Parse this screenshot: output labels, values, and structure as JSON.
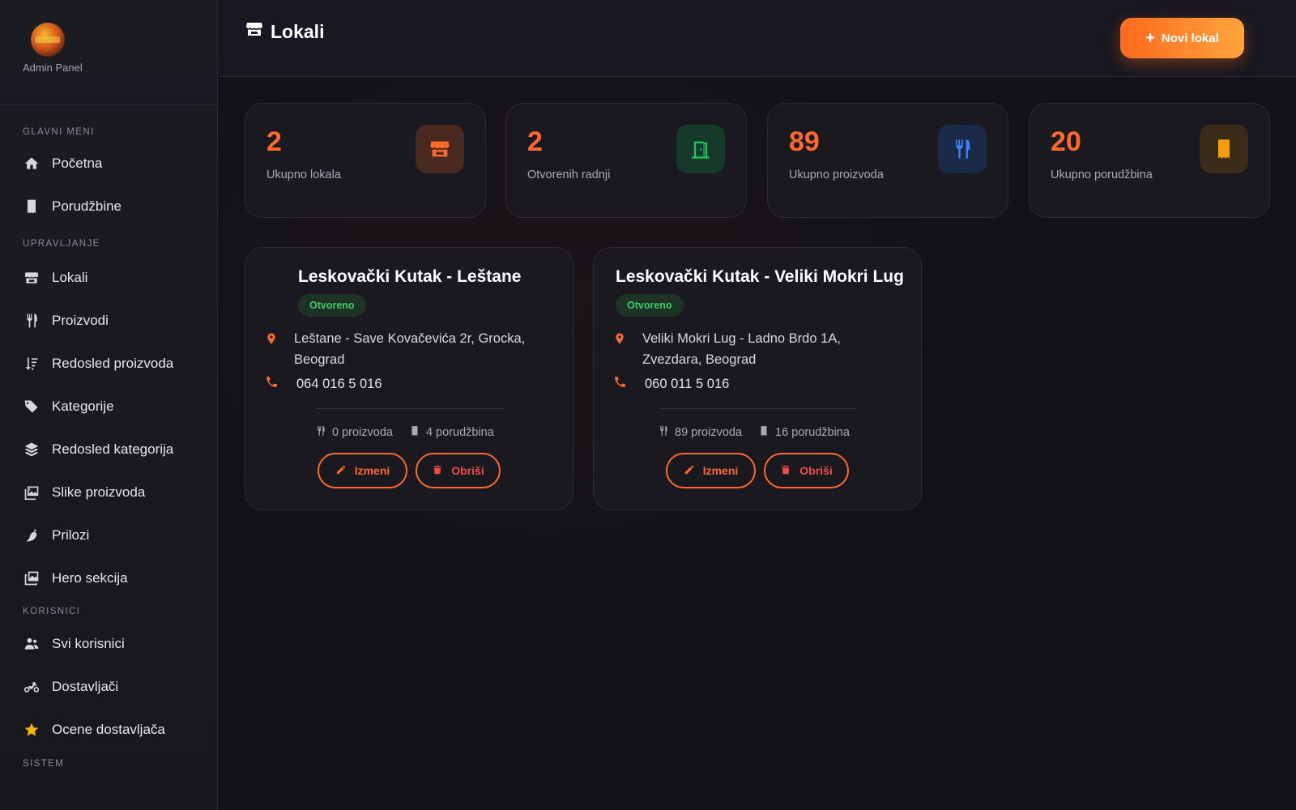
{
  "sidebar": {
    "brand_subtitle": "Admin Panel",
    "sections": [
      {
        "label": "GLAVNI MENI"
      },
      {
        "label": "UPRAVLJANJE"
      },
      {
        "label": "KORISNICI"
      },
      {
        "label": "SISTEM"
      }
    ],
    "items": [
      {
        "label": "Početna",
        "icon": "home-icon"
      },
      {
        "label": "Porudžbine",
        "icon": "receipt-icon"
      },
      {
        "label": "Lokali",
        "icon": "store-icon"
      },
      {
        "label": "Proizvodi",
        "icon": "utensils-icon"
      },
      {
        "label": "Redosled proizvoda",
        "icon": "sort-icon"
      },
      {
        "label": "Kategorije",
        "icon": "tags-icon"
      },
      {
        "label": "Redosled kategorija",
        "icon": "layers-icon"
      },
      {
        "label": "Slike proizvoda",
        "icon": "images-icon"
      },
      {
        "label": "Prilozi",
        "icon": "pepper-icon"
      },
      {
        "label": "Hero sekcija",
        "icon": "photo-film-icon"
      },
      {
        "label": "Svi korisnici",
        "icon": "users-icon"
      },
      {
        "label": "Dostavljači",
        "icon": "motorcycle-icon"
      },
      {
        "label": "Ocene dostavljača",
        "icon": "star-icon"
      }
    ]
  },
  "header": {
    "title": "Lokali",
    "new_button_label": "Novi lokal"
  },
  "stats": [
    {
      "value": "2",
      "label": "Ukupno lokala",
      "icon": "store-icon",
      "color": "#ff6a2a"
    },
    {
      "value": "2",
      "label": "Otvorenih radnji",
      "icon": "door-open-icon",
      "color": "#22c55e"
    },
    {
      "value": "89",
      "label": "Ukupno proizvoda",
      "icon": "utensils-icon",
      "color": "#3b82f6"
    },
    {
      "value": "20",
      "label": "Ukupno porudžbina",
      "icon": "receipt-icon",
      "color": "#f59e0b"
    }
  ],
  "locations": [
    {
      "name": "Leskovački Kutak - Leštane",
      "status": "Otvoreno",
      "address_line1": "Leštane - Save Kovačevića 2r, Grocka,",
      "address_line2": "Beograd",
      "phone": "064 016 5 016",
      "products": "0 proizvoda",
      "orders": "4 porudžbina",
      "edit_label": "Izmeni",
      "delete_label": "Obriši"
    },
    {
      "name": "Leskovački Kutak - Veliki Mokri Lug",
      "status": "Otvoreno",
      "address_line1": "Veliki Mokri Lug - Ladno Brdo 1A,",
      "address_line2": "Zvezdara, Beograd",
      "phone": "060 011 5 016",
      "products": "89 proizvoda",
      "orders": "16 porudžbina",
      "edit_label": "Izmeni",
      "delete_label": "Obriši"
    }
  ],
  "colors": {
    "accent": "#ff6a2a",
    "open_badge": "#3fcb6c",
    "danger": "#f04a4a"
  }
}
